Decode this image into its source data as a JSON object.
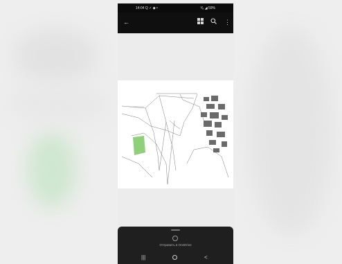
{
  "status_bar": {
    "time": "14:04",
    "indicators": "Q ✓ ◆ •",
    "right": "⁰⁄₈ ◢ 59%"
  },
  "app_bar": {
    "back_icon": "arrow-back-icon",
    "grid_icon": "grid-view-icon",
    "search_icon": "search-icon",
    "more_icon": "more-vert-icon"
  },
  "document": {
    "type": "map-plan-sheet",
    "accent_green": "#8fd07a"
  },
  "bottom_sheet": {
    "share_label": "Отправить в OneDrive",
    "share_icon": "cloud-share-icon"
  },
  "nav_bar": {
    "recent_icon": "recents-icon",
    "home_icon": "home-icon",
    "back_icon": "back-icon"
  },
  "colors": {
    "status_bar": "#0b0b0b",
    "sheet": "#1f1f1f",
    "viewer_bg": "#ececec"
  }
}
